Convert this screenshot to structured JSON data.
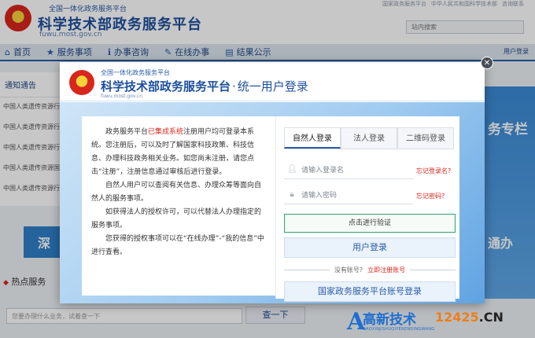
{
  "background": {
    "header": {
      "subtitle": "全国一体化政务服务平台",
      "title": "科学技术部政务服务平台",
      "domain": "fuwu.most.gov.cn",
      "top_links": [
        "国家政务服务平台",
        "中华人民共和国科学技术部",
        "咨询联系"
      ],
      "search_placeholder": "站内搜索"
    },
    "nav": {
      "items": [
        {
          "label": "首页",
          "icon": "home-icon"
        },
        {
          "label": "服务事项",
          "icon": "star-icon"
        },
        {
          "label": "办事咨询",
          "icon": "info-icon"
        },
        {
          "label": "在线办事",
          "icon": "pen-icon"
        },
        {
          "label": "结果公示",
          "icon": "doc-icon"
        }
      ],
      "user_text": "用户登录"
    },
    "notice": {
      "title": "通知通告",
      "rows": [
        "中国人类遗传资源行",
        "中国人类遗传资源行",
        "中国人类遗传资源行",
        "中国人类遗传资源国",
        "中国人类遗传资源行"
      ]
    },
    "deep_label": "深",
    "hot_label": "热点服务",
    "bottom_search_placeholder": "您要办理什么业务，试着查一下",
    "bottom_search_button": "查一下",
    "right_banner_text1": "务专栏",
    "right_banner_text2": "通办"
  },
  "modal": {
    "close_glyph": "✕",
    "subtitle": "全国一体化政务服务平台",
    "title": "科学技术部政务服务平台",
    "title_sep": "·",
    "title_suffix": "统一用户登录",
    "domain": "fuwu.most.gov.cn",
    "info": {
      "p1_a": "政务服务平台",
      "p1_highlight": "已集成系统",
      "p1_b": "注册用户均可登录本系统。您注册后，可以及时了解国家科技政策、科技信息、办理科技政务相关业务。如您尚未注册，请您点击“注册”，注册信息通过审核后进行登录。",
      "p2": "自然人用户可以查阅有关信息、办理众筹等面向自然人的服务事项。",
      "p3": "如获得法人的授权许可，可以代替法人办理指定的服务事项。",
      "p4": "您获得的授权事项可以在“在线办理”-“我的信息”中进行查看。"
    },
    "form": {
      "tabs": [
        "自然人登录",
        "法人登录",
        "二维码登录"
      ],
      "active_tab": 0,
      "username_placeholder": "请输入登录名",
      "forgot_username": "忘记登录名?",
      "password_placeholder": "请输入密码",
      "forgot_password": "忘记密码?",
      "verify_label": "点击进行验证",
      "login_label": "用户登录",
      "no_account": "没有账号?",
      "register_link": "立即注册账号",
      "gov_login_label": "国家政务服务平台账号登录"
    }
  },
  "watermark": {
    "letter": "A",
    "cn": "高新技术",
    "pinyin": "GAOXINJISHUQIYERENDINGWANG",
    "num": "12425",
    "tld": ".CN"
  }
}
